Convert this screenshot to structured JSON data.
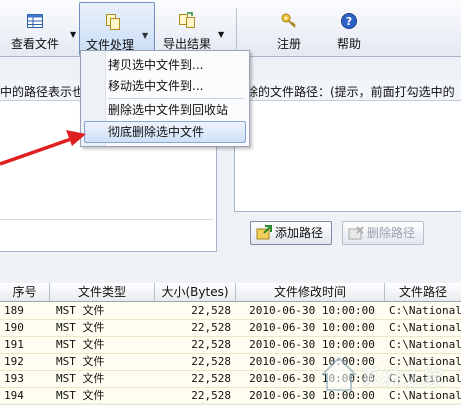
{
  "toolbar": {
    "view_files": "查看文件",
    "file_process": "文件处理",
    "export_results": "导出结果",
    "register": "注册",
    "help": "帮助"
  },
  "strip": {
    "left_text": "中的路径表示也",
    "right_text": "除的文件路径：(提示，前面打勾选中的"
  },
  "menu": {
    "items": [
      "拷贝选中文件到...",
      "移动选中文件到...",
      "删除选中文件到回收站",
      "彻底删除选中文件"
    ],
    "highlighted_index": 3
  },
  "buttons": {
    "add_path": "添加路径",
    "delete_path": "删除路径"
  },
  "table": {
    "columns": [
      "序号",
      "文件类型",
      "大小(Bytes)",
      "文件修改时间",
      "文件路径"
    ],
    "rows": [
      [
        "189",
        "MST 文件",
        "22,528",
        "2010-06-30 10:00:00",
        "C:\\National"
      ],
      [
        "190",
        "MST 文件",
        "22,528",
        "2010-06-30 10:00:00",
        "C:\\National"
      ],
      [
        "191",
        "MST 文件",
        "22,528",
        "2010-06-30 10:00:00",
        "C:\\National"
      ],
      [
        "192",
        "MST 文件",
        "22,528",
        "2010-06-30 10:00:00",
        "C:\\National"
      ],
      [
        "193",
        "MST 文件",
        "22,528",
        "2010-06-30 10:00:00",
        "C:\\National"
      ],
      [
        "194",
        "MST 文件",
        "22,528",
        "2010-06-30 10:00:00",
        "C:\\National"
      ]
    ]
  },
  "colors": {
    "accent_arrow": "#e02020",
    "row_background": "#fffef0",
    "menu_highlight": "#cfe0f7"
  },
  "watermark": {
    "text": "系统之家"
  }
}
